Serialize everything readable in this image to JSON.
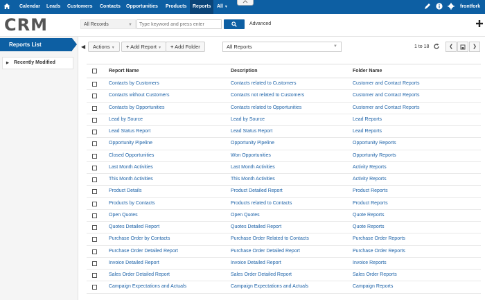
{
  "nav": {
    "items": [
      "Calendar",
      "Leads",
      "Customers",
      "Contacts",
      "Opportunities",
      "Products",
      "Reports",
      "All"
    ],
    "active": "Reports",
    "user": "frontfork"
  },
  "header": {
    "logo": "CRM",
    "search_scope": "All Records",
    "search_placeholder": "Type keyword and press enter",
    "advanced_label": "Advanced"
  },
  "sidebar": {
    "title": "Reports List",
    "items": [
      "Recently Modified"
    ]
  },
  "toolbar": {
    "actions_label": "Actions",
    "add_report_label": "Add Report",
    "add_folder_label": "Add Folder",
    "folder_filter": "All Reports",
    "pagination": "1 to 18"
  },
  "table": {
    "columns": [
      "Report Name",
      "Description",
      "Folder Name"
    ],
    "rows": [
      [
        "Contacts by Customers",
        "Contacts related to Customers",
        "Customer and Contact Reports"
      ],
      [
        "Contacts without Customers",
        "Contacts not related to Customers",
        "Customer and Contact Reports"
      ],
      [
        "Contacts by Opportunities",
        "Contacts related to Opportunities",
        "Customer and Contact Reports"
      ],
      [
        "Lead by Source",
        "Lead by Source",
        "Lead Reports"
      ],
      [
        "Lead Status Report",
        "Lead Status Report",
        "Lead Reports"
      ],
      [
        "Opportunity Pipeline",
        "Opportunity Pipeline",
        "Opportunity Reports"
      ],
      [
        "Closed Opportunities",
        "Won Opportunities",
        "Opportunity Reports"
      ],
      [
        "Last Month Activities",
        "Last Month Activities",
        "Activity Reports"
      ],
      [
        "This Month Activities",
        "This Month Activities",
        "Activity Reports"
      ],
      [
        "Product Details",
        "Product Detailed Report",
        "Product Reports"
      ],
      [
        "Products by Contacts",
        "Products related to Contacts",
        "Product Reports"
      ],
      [
        "Open Quotes",
        "Open Quotes",
        "Quote Reports"
      ],
      [
        "Quotes Detailed Report",
        "Quotes Detailed Report",
        "Quote Reports"
      ],
      [
        "Purchase Order by Contacts",
        "Purchase Order Related to Contacts",
        "Purchase Order Reports"
      ],
      [
        "Purchase Order Detailed Report",
        "Purchase Order Detailed Report",
        "Purchase Order Reports"
      ],
      [
        "Invoice Detailed Report",
        "Invoice Detailed Report",
        "Invoice Reports"
      ],
      [
        "Sales Order Detailed Report",
        "Sales Order Detailed Report",
        "Sales Order Reports"
      ],
      [
        "Campaign Expectations and Actuals",
        "Campaign Expectations and Actuals",
        "Campaign Reports"
      ]
    ]
  },
  "colors": {
    "brand": "#0d5fa3",
    "link": "#1e63a8"
  }
}
